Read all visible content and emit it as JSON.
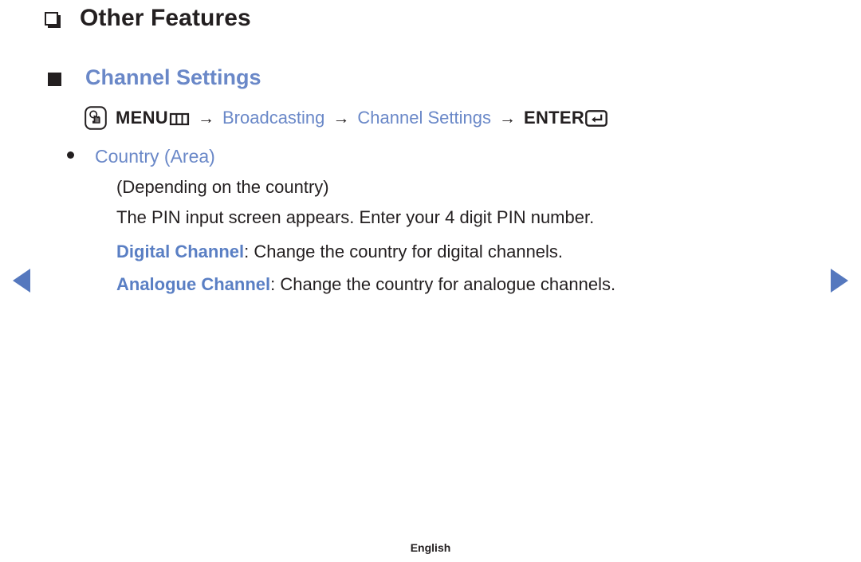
{
  "page": {
    "title": "Other Features",
    "section_title": "Channel Settings",
    "footer_language": "English"
  },
  "menu_path": {
    "key_icon": "remote-menu-key-icon",
    "menu_label": "MENU",
    "panes_icon": "menu-panes-icon",
    "separator": "→",
    "step_broadcasting": "Broadcasting",
    "step_channel_settings": "Channel Settings",
    "enter_label": "ENTER",
    "enter_icon": "enter-return-icon"
  },
  "content": {
    "bullet_item": "Country (Area)",
    "note": "(Depending on the country)",
    "pin_line": "The PIN input screen appears. Enter your 4 digit PIN number.",
    "digital_term": "Digital Channel",
    "digital_desc": ": Change the country for digital channels.",
    "analogue_term": "Analogue Channel",
    "analogue_desc": ": Change the country for analogue channels."
  },
  "navigation": {
    "prev_label": "Previous page",
    "next_label": "Next page"
  },
  "colors": {
    "accent_blue": "#6a88c8",
    "term_blue": "#5a7fc4",
    "arrow_blue": "#5578be",
    "text_dark": "#231f20"
  }
}
